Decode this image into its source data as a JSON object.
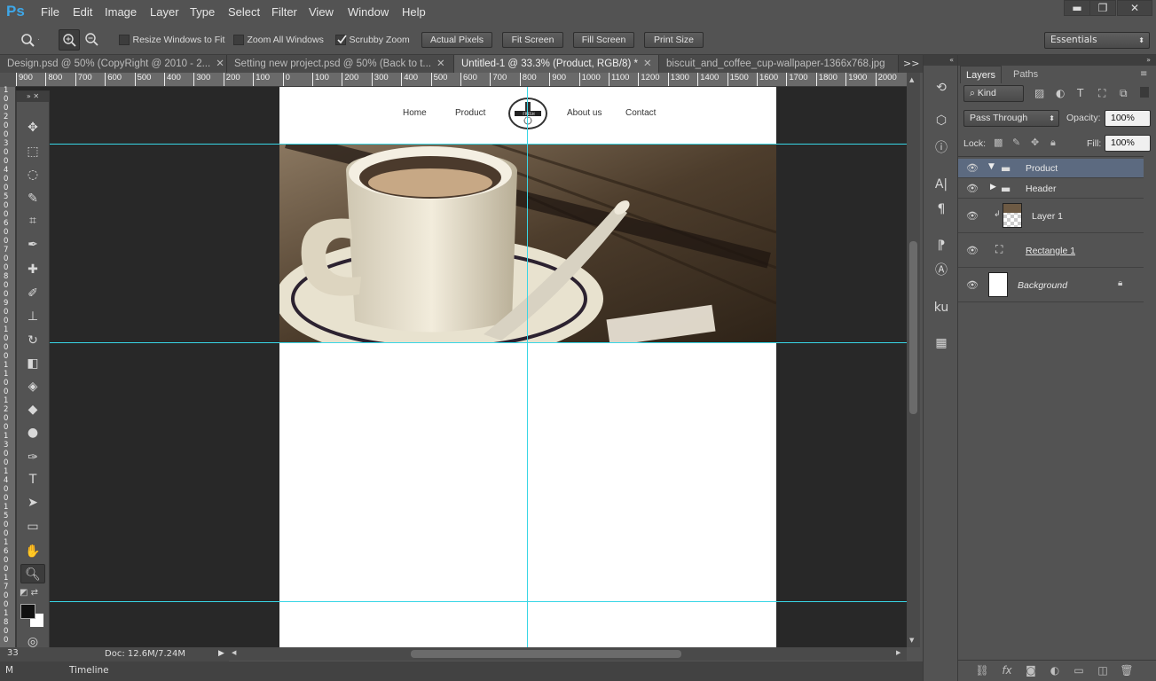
{
  "app": {
    "logo": "Ps",
    "menu": [
      "File",
      "Edit",
      "Image",
      "Layer",
      "Type",
      "Select",
      "Filter",
      "View",
      "Window",
      "Help"
    ],
    "window_buttons": {
      "minimize": "▬",
      "restore": "❐",
      "close": "✕"
    }
  },
  "options_bar": {
    "resize_windows_label": "Resize Windows to Fit",
    "resize_windows_checked": false,
    "zoom_all_label": "Zoom All Windows",
    "zoom_all_checked": false,
    "scrubby_zoom_label": "Scrubby Zoom",
    "scrubby_zoom_checked": true,
    "actual_pixels": "Actual Pixels",
    "fit_screen": "Fit Screen",
    "fill_screen": "Fill Screen",
    "print_size": "Print Size",
    "workspace": "Essentials"
  },
  "tabs": [
    {
      "label": "Design.psd @ 50% (CopyRight @ 2010 - 2...",
      "active": false
    },
    {
      "label": "Setting new project.psd @ 50% (Back to t...",
      "active": false
    },
    {
      "label": "Untitled-1 @ 33.3% (Product, RGB/8) *",
      "active": true
    },
    {
      "label": "biscuit_and_coffee_cup-wallpaper-1366x768.jpg",
      "active": false
    }
  ],
  "tab_overflow": ">>",
  "ruler_h": [
    "900",
    "800",
    "700",
    "600",
    "500",
    "400",
    "300",
    "200",
    "100",
    "0",
    "100",
    "200",
    "300",
    "400",
    "500",
    "600",
    "700",
    "800",
    "900",
    "1000",
    "1100",
    "1200",
    "1300",
    "1400",
    "1500",
    "1600",
    "1700",
    "1800",
    "1900",
    "2000"
  ],
  "ruler_v": [
    "1",
    "0",
    "0",
    "2",
    "0",
    "0",
    "3",
    "0",
    "0",
    "4",
    "0",
    "0",
    "5",
    "0",
    "0",
    "6",
    "0",
    "0",
    "7",
    "0",
    "0",
    "8",
    "0",
    "0",
    "9",
    "0",
    "0",
    "1",
    "0",
    "0",
    "0",
    "1",
    "1",
    "0",
    "0",
    "1",
    "2",
    "0",
    "0",
    "1",
    "3",
    "0",
    "0",
    "1",
    "4",
    "0",
    "0",
    "1",
    "5",
    "0",
    "0",
    "1",
    "6",
    "0",
    "0",
    "1",
    "7",
    "0",
    "0",
    "1",
    "8",
    "0",
    "0"
  ],
  "document": {
    "nav": {
      "home": "Home",
      "product": "Product",
      "about": "About us",
      "contact": "Contact"
    },
    "logo_text": "FRESH COFFEE"
  },
  "status": {
    "zoom": "33",
    "doc_size": "Doc: 12.6M/7.24M"
  },
  "bottom_tabs": {
    "mini_bridge": "M",
    "timeline": "Timeline"
  },
  "layers_panel": {
    "tabs": [
      "Layers",
      "Paths"
    ],
    "kind_filter": "Kind",
    "blend_mode": "Pass Through",
    "opacity_label": "Opacity:",
    "opacity_value": "100%",
    "lock_label": "Lock:",
    "fill_label": "Fill:",
    "fill_value": "100%",
    "layers": [
      {
        "name": "Product",
        "type": "group",
        "expanded": true,
        "selected": true,
        "visible": true
      },
      {
        "name": "Header",
        "type": "group",
        "expanded": false,
        "selected": false,
        "visible": true
      },
      {
        "name": "Layer 1",
        "type": "image",
        "selected": false,
        "visible": true
      },
      {
        "name": "Rectangle 1",
        "type": "shape",
        "selected": false,
        "visible": true
      },
      {
        "name": "Background",
        "type": "background",
        "selected": false,
        "visible": true,
        "locked": true
      }
    ]
  },
  "colors": {
    "guide": "#38d6e6",
    "ps_blue": "#3ea7e8",
    "selected_layer": "#5c6a80"
  }
}
